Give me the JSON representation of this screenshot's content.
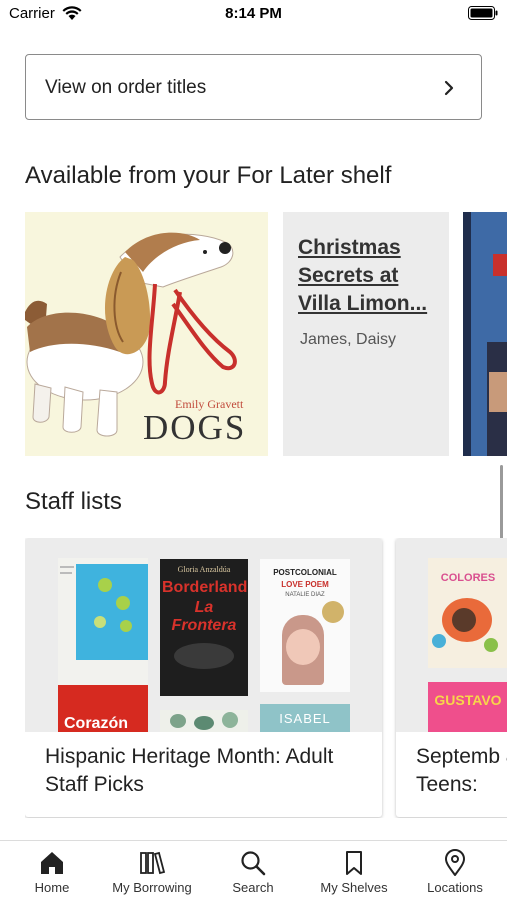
{
  "status_bar": {
    "carrier": "Carrier",
    "time": "8:14 PM"
  },
  "order_card": {
    "label": "View on order titles",
    "icon": "chevron-right-icon"
  },
  "for_later": {
    "heading": "Available from your For Later shelf",
    "items": [
      {
        "type": "cover",
        "title": "DOGS",
        "author": "Emily Gravett",
        "background": "#f8f6dd"
      },
      {
        "type": "text",
        "title": "Christmas Secrets at Villa Limon...",
        "author": "James, Daisy"
      },
      {
        "type": "cover-partial"
      }
    ]
  },
  "staff_lists": {
    "heading": "Staff lists",
    "cards": [
      {
        "title": "Hispanic Heritage Month: Adult Staff Picks",
        "book_texts": [
          "Borderlands",
          "La Frontera",
          "Gloria Anzaldúa",
          "POSTCOLONIAL",
          "LOVE POEM",
          "NATALIE DIAZ",
          "Corazón",
          "ISABEL"
        ]
      },
      {
        "title": "Septemb & Teens:",
        "book_texts": [
          "COLORES",
          "GUSTAVO"
        ]
      }
    ]
  },
  "tab_bar": {
    "tabs": [
      {
        "label": "Home",
        "icon": "home-icon"
      },
      {
        "label": "My Borrowing",
        "icon": "books-icon"
      },
      {
        "label": "Search",
        "icon": "search-icon"
      },
      {
        "label": "My Shelves",
        "icon": "bookmark-icon"
      },
      {
        "label": "Locations",
        "icon": "location-pin-icon"
      }
    ]
  },
  "colors": {
    "accent_red": "#c8302c",
    "card_gray": "#ececec",
    "cover_cream": "#f8f6dd"
  }
}
